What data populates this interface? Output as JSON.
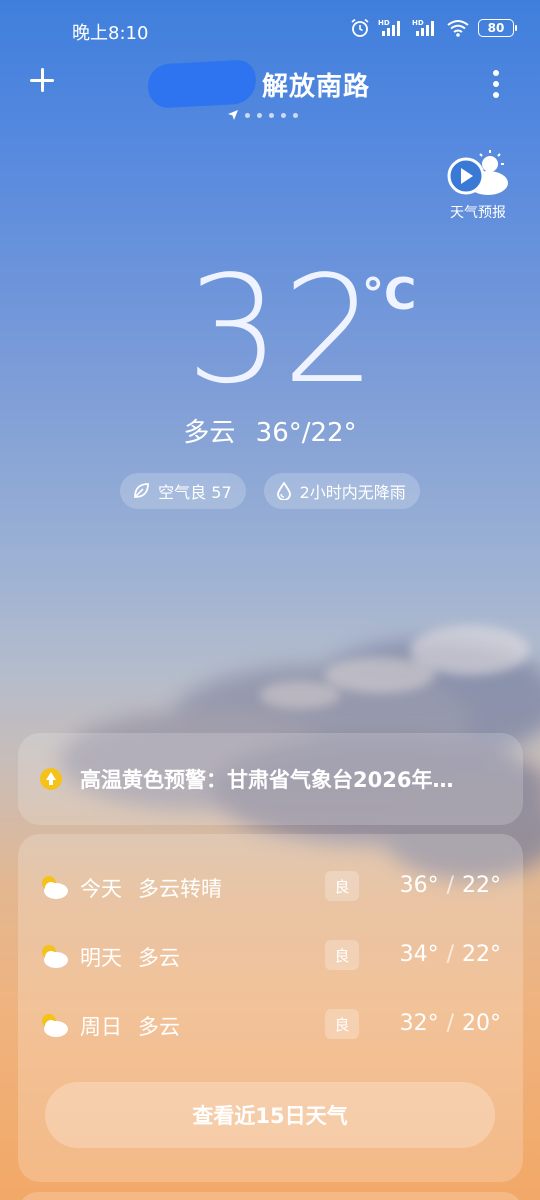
{
  "status_bar": {
    "time": "晚上8:10",
    "battery": "80",
    "hd_label": "HD"
  },
  "header": {
    "location": "解放南路",
    "page_count": 6
  },
  "forecast_video": {
    "label": "天气预报",
    "icon": "play-cloud-sun-icon"
  },
  "current": {
    "temperature": "32",
    "unit": "°C",
    "condition": "多云",
    "high_low": "36°/22°"
  },
  "chips": [
    {
      "icon": "leaf-icon",
      "label": "空气良 57"
    },
    {
      "icon": "raindrop-icon",
      "label": "2小时内无降雨"
    }
  ],
  "alert": {
    "icon": "warning-arrow-icon",
    "icon_color": "#f4c21a",
    "text": "高温黄色预警：甘肃省气象台2026年…"
  },
  "forecast": {
    "days": [
      {
        "name": "今天",
        "condition": "多云转晴",
        "aqi": "良",
        "high": "36°",
        "low": "22°",
        "icon": "cloud-sun-icon"
      },
      {
        "name": "明天",
        "condition": "多云",
        "aqi": "良",
        "high": "34°",
        "low": "22°",
        "icon": "cloud-sun-icon"
      },
      {
        "name": "周日",
        "condition": "多云",
        "aqi": "良",
        "high": "32°",
        "low": "20°",
        "icon": "cloud-sun-icon"
      }
    ],
    "cta_label": "查看近15日天气"
  }
}
